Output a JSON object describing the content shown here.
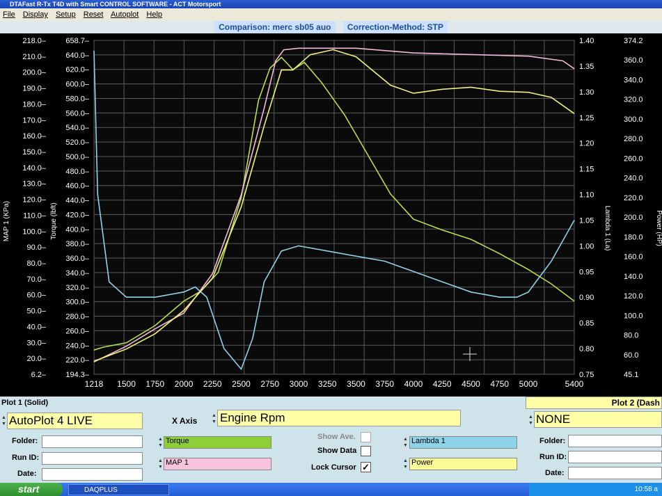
{
  "window": {
    "title": "DTAFast R-Tx T4D with Smart CONTROL SOFTWARE - ACT Motorsport"
  },
  "menu": [
    "File",
    "Display",
    "Setup",
    "Reset",
    "Autoplot",
    "Help"
  ],
  "header": {
    "comparison": "Comparison: merc sb05 auo",
    "correction": "Correction-Method: STP"
  },
  "chart_data": {
    "type": "line",
    "xlabel": "",
    "x_ticks": [
      "1218",
      "1500",
      "1750",
      "2000",
      "2250",
      "2500",
      "2750",
      "3000",
      "3250",
      "3500",
      "3750",
      "4000",
      "4250",
      "4500",
      "4750",
      "5000",
      "5400"
    ],
    "xlim": [
      1218,
      5400
    ],
    "axes": {
      "map": {
        "label": "MAP 1 (KPa)",
        "ticks": [
          "218.0",
          "210.0",
          "200.0",
          "190.0",
          "180.0",
          "170.0",
          "160.0",
          "150.0",
          "140.0",
          "130.0",
          "120.0",
          "110.0",
          "100.0",
          "90.0",
          "80.0",
          "70.0",
          "60.0",
          "50.0",
          "40.0",
          "30.0",
          "20.0",
          "6.2"
        ],
        "range": [
          6.2,
          218.0
        ]
      },
      "torque": {
        "label": "Torque (lbft)",
        "ticks": [
          "658.7",
          "640.0",
          "620.0",
          "600.0",
          "580.0",
          "560.0",
          "540.0",
          "520.0",
          "500.0",
          "480.0",
          "460.0",
          "440.0",
          "420.0",
          "400.0",
          "380.0",
          "360.0",
          "340.0",
          "320.0",
          "300.0",
          "280.0",
          "260.0",
          "240.0",
          "220.0",
          "194.3"
        ],
        "range": [
          194.3,
          658.7
        ]
      },
      "lambda": {
        "label": "Lambda 1 (La)",
        "ticks": [
          "1.40",
          "1.35",
          "1.30",
          "1.25",
          "1.20",
          "1.15",
          "1.10",
          "1.05",
          "1.00",
          "0.95",
          "0.90",
          "0.85",
          "0.80",
          "0.75"
        ],
        "range": [
          0.75,
          1.4
        ]
      },
      "power": {
        "label": "Power (HP)",
        "ticks": [
          "374.2",
          "360.0",
          "340.0",
          "320.0",
          "300.0",
          "280.0",
          "260.0",
          "240.0",
          "220.0",
          "200.0",
          "180.0",
          "160.0",
          "140.0",
          "120.0",
          "100.0",
          "80.0",
          "60.0",
          "45.1"
        ],
        "range": [
          45.1,
          374.2
        ]
      }
    },
    "series": [
      {
        "name": "Torque",
        "color": "#b8e04a",
        "axis": "torque",
        "x": [
          1218,
          1300,
          1500,
          1750,
          2000,
          2150,
          2300,
          2500,
          2650,
          2750,
          2850,
          2950,
          3050,
          3200,
          3400,
          3600,
          3800,
          4000,
          4250,
          4500,
          4750,
          5000,
          5200,
          5400
        ],
        "y": [
          228,
          232,
          238,
          262,
          296,
          310,
          336,
          440,
          575,
          620,
          635,
          618,
          628,
          600,
          555,
          500,
          445,
          410,
          395,
          382,
          362,
          340,
          320,
          296
        ]
      },
      {
        "name": "MAP 1",
        "color": "#f4b8d8",
        "axis": "map",
        "x": [
          1218,
          1500,
          1750,
          2000,
          2250,
          2500,
          2700,
          2800,
          2870,
          3000,
          3500,
          4000,
          4500,
          5000,
          5300,
          5400
        ],
        "y": [
          14,
          24,
          35,
          45,
          70,
          120,
          175,
          205,
          212,
          213,
          213,
          210,
          209,
          208,
          205,
          200
        ]
      },
      {
        "name": "Lambda 1",
        "color": "#8fd3e8",
        "axis": "lambda",
        "x": [
          1218,
          1250,
          1350,
          1500,
          1750,
          2000,
          2100,
          2200,
          2350,
          2500,
          2600,
          2700,
          2850,
          3000,
          3250,
          3500,
          3750,
          4000,
          4250,
          4500,
          4750,
          4900,
          5000,
          5200,
          5400
        ],
        "y": [
          1.38,
          1.1,
          0.93,
          0.9,
          0.9,
          0.91,
          0.92,
          0.9,
          0.8,
          0.76,
          0.82,
          0.93,
          0.99,
          1.0,
          0.99,
          0.98,
          0.97,
          0.95,
          0.93,
          0.91,
          0.9,
          0.9,
          0.91,
          0.97,
          1.05
        ]
      },
      {
        "name": "Power",
        "color": "#f2f27a",
        "axis": "power",
        "x": [
          1218,
          1500,
          1750,
          2000,
          2250,
          2500,
          2700,
          2850,
          2950,
          3100,
          3300,
          3500,
          3800,
          4000,
          4250,
          4500,
          4750,
          5000,
          5200,
          5400
        ],
        "y": [
          58,
          70,
          85,
          108,
          140,
          210,
          290,
          345,
          345,
          360,
          365,
          358,
          330,
          322,
          326,
          328,
          324,
          323,
          318,
          302
        ]
      }
    ]
  },
  "plot1": {
    "header": "Plot 1 (Solid)",
    "selector": "AutoPlot 4 LIVE",
    "folder_label": "Folder:",
    "runid_label": "Run ID:",
    "date_label": "Date:"
  },
  "xaxis": {
    "label": "X Axis",
    "value": "Engine Rpm"
  },
  "series_selectors": {
    "left1": "Torque",
    "left2": "MAP 1",
    "right1": "Lambda 1",
    "right2": "Power"
  },
  "options": {
    "show_ave": "Show Ave.",
    "show_data": "Show Data",
    "lock_cursor": "Lock Cursor"
  },
  "plot2": {
    "header": "Plot 2 (Dash",
    "selector": "NONE",
    "folder_label": "Folder:",
    "runid_label": "Run ID:",
    "date_label": "Date:"
  },
  "taskbar": {
    "start": "start",
    "app": "DAQPLUS",
    "clock": "10:58 a"
  }
}
